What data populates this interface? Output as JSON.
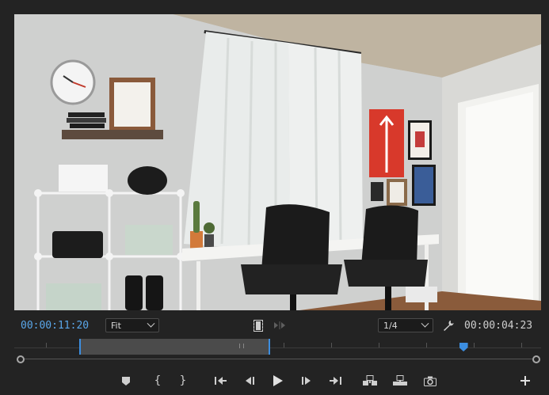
{
  "monitor": {
    "current_timecode": "00:00:11:20",
    "duration_timecode": "00:00:04:23",
    "zoom": {
      "selected": "Fit"
    },
    "resolution": {
      "selected": "1/4"
    }
  },
  "timeline": {
    "playhead_fraction": 0.852,
    "in_fraction": 0.123,
    "out_fraction": 0.485
  },
  "colors": {
    "accent": "#3c8ee0",
    "timecode_active": "#5aa7ea",
    "panel_bg": "#232323"
  },
  "transport": {
    "buttons": [
      "add-marker",
      "mark-in",
      "mark-out",
      "go-to-in",
      "step-back",
      "play",
      "step-forward",
      "go-to-out",
      "insert",
      "overwrite",
      "export-frame",
      "button-editor"
    ]
  }
}
